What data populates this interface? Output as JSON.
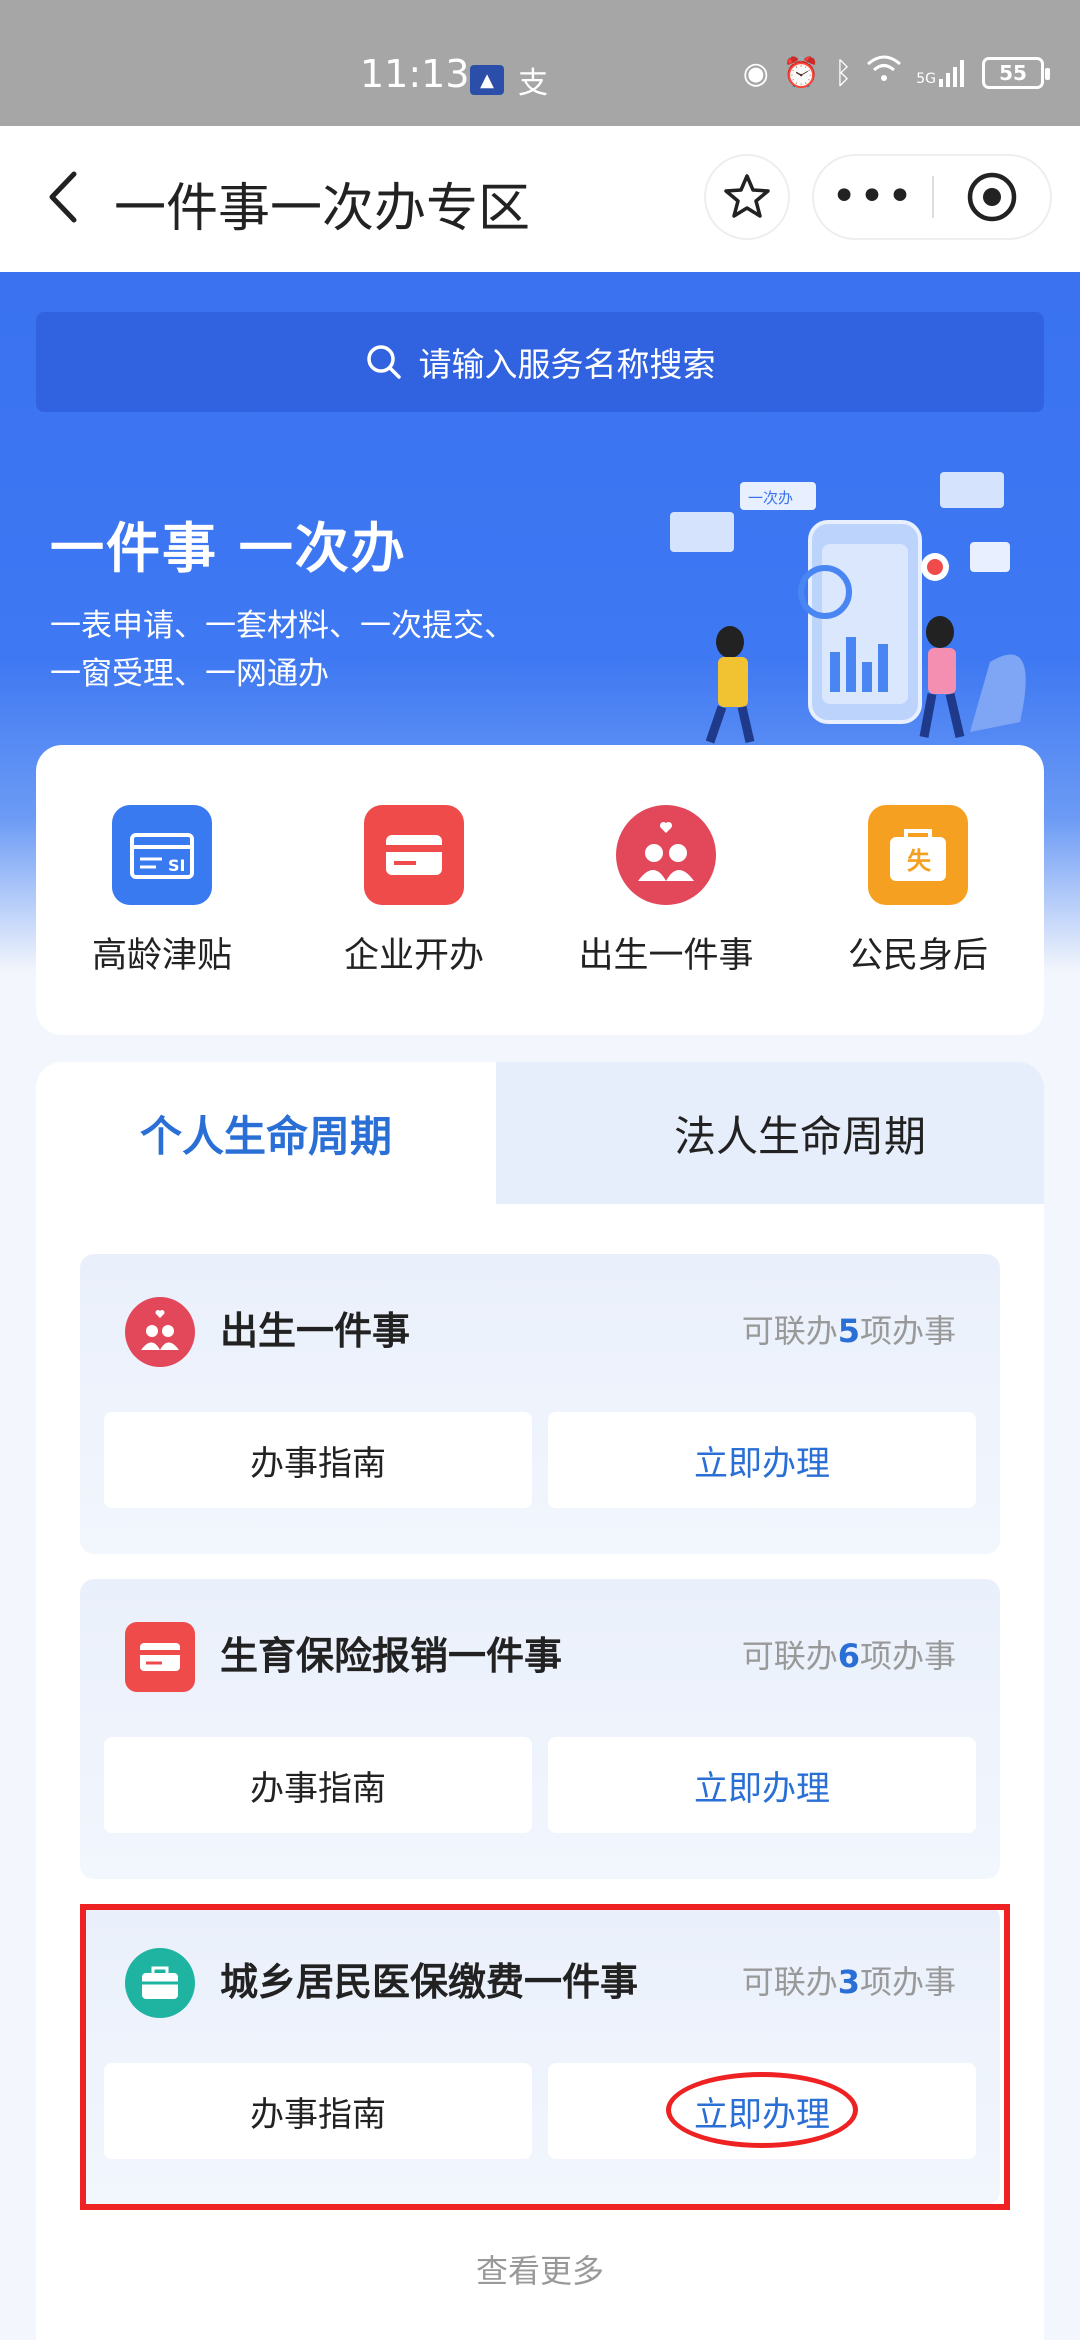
{
  "status_bar": {
    "time": "11:13",
    "battery": "55",
    "network": "5G"
  },
  "title_bar": {
    "title": "一件事一次办专区",
    "more_label": "•••"
  },
  "search": {
    "placeholder": "请输入服务名称搜索"
  },
  "hero": {
    "title": "一件事 一次办",
    "subtitle_line1": "一表申请、一套材料、一次提交、",
    "subtitle_line2": "一窗受理、一网通办",
    "illustration_badge": "一次办"
  },
  "services": [
    {
      "label": "高龄津贴",
      "icon": "card-si-icon",
      "color": "#3a7af0"
    },
    {
      "label": "企业开办",
      "icon": "wallet-card-icon",
      "color": "#ef4b4b"
    },
    {
      "label": "出生一件事",
      "icon": "family-heart-icon",
      "color": "#e2475a"
    },
    {
      "label": "公民身后",
      "icon": "bag-shi-icon",
      "color": "#f5a020"
    }
  ],
  "tabs": {
    "personal": "个人生命周期",
    "legal": "法人生命周期"
  },
  "items": [
    {
      "title": "出生一件事",
      "count_prefix": "可联办",
      "count": "5",
      "count_suffix": "项办事",
      "guide": "办事指南",
      "apply": "立即办理"
    },
    {
      "title": "生育保险报销一件事",
      "count_prefix": "可联办",
      "count": "6",
      "count_suffix": "项办事",
      "guide": "办事指南",
      "apply": "立即办理"
    },
    {
      "title": "城乡居民医保缴费一件事",
      "count_prefix": "可联办",
      "count": "3",
      "count_suffix": "项办事",
      "guide": "办事指南",
      "apply": "立即办理"
    }
  ],
  "more_link": "查看更多",
  "colors": {
    "brand_blue": "#3a72f0",
    "accent_text": "#2a6fd6",
    "highlight": "#e22222"
  }
}
